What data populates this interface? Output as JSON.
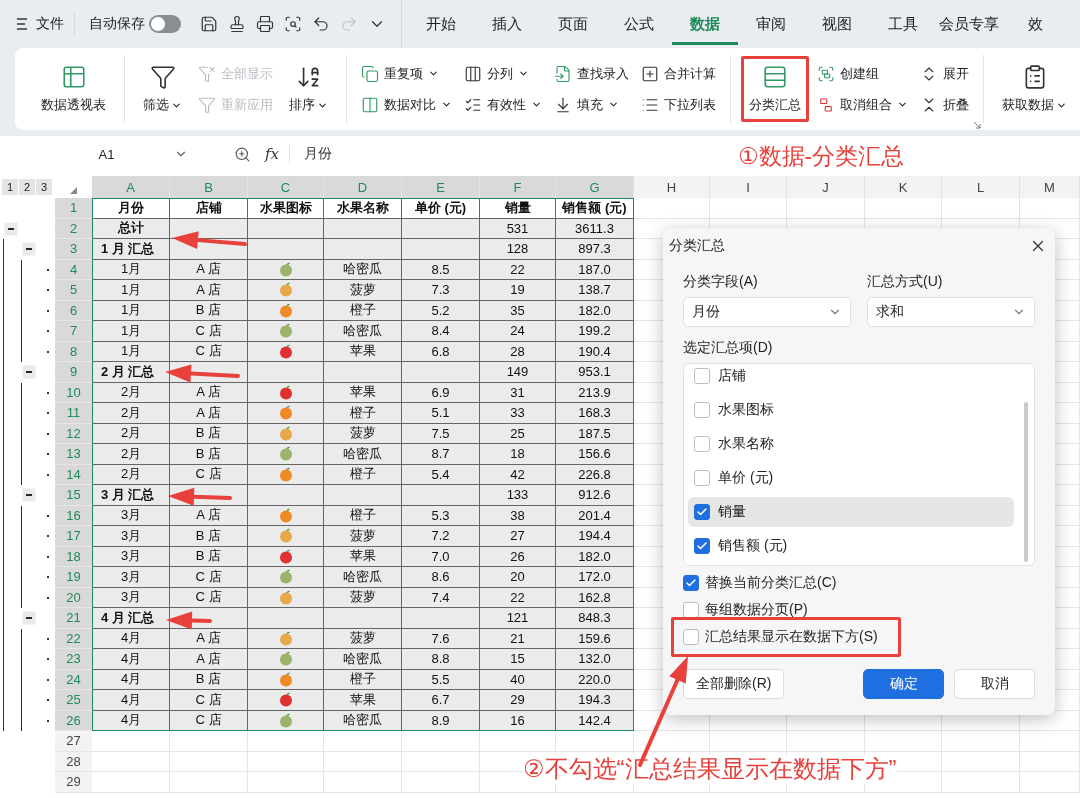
{
  "topbar": {
    "file_menu": "文件",
    "autosave": {
      "label": "自动保存",
      "on": false
    },
    "tabs": [
      {
        "label": "开始",
        "selected": false
      },
      {
        "label": "插入",
        "selected": false
      },
      {
        "label": "页面",
        "selected": false
      },
      {
        "label": "公式",
        "selected": false
      },
      {
        "label": "数据",
        "selected": true
      },
      {
        "label": "审阅",
        "selected": false
      },
      {
        "label": "视图",
        "selected": false
      },
      {
        "label": "工具",
        "selected": false
      },
      {
        "label": "会员专享",
        "selected": false
      },
      {
        "label": "效",
        "selected": false
      }
    ]
  },
  "ribbon": [
    {
      "items": [
        {
          "kind": "large",
          "label": "数据透视表",
          "dropdown": false
        }
      ]
    },
    {
      "items": [
        {
          "kind": "large",
          "label": "筛选",
          "dropdown": true
        },
        {
          "kind": "stack",
          "buttons": [
            {
              "label": "全部显示",
              "dropdown": false,
              "disabled": true
            },
            {
              "label": "重新应用",
              "dropdown": false,
              "disabled": true
            }
          ]
        },
        {
          "kind": "large",
          "label": "排序",
          "dropdown": true
        }
      ]
    },
    {
      "items": [
        {
          "kind": "stack",
          "buttons": [
            {
              "label": "重复项",
              "dropdown": true,
              "disabled": false
            },
            {
              "label": "数据对比",
              "dropdown": true,
              "disabled": false
            }
          ]
        },
        {
          "kind": "stack",
          "buttons": [
            {
              "label": "分列",
              "dropdown": true,
              "disabled": false
            },
            {
              "label": "有效性",
              "dropdown": true,
              "disabled": false
            }
          ]
        },
        {
          "kind": "stack",
          "buttons": [
            {
              "label": "查找录入",
              "dropdown": false,
              "disabled": false
            },
            {
              "label": "填充",
              "dropdown": true,
              "disabled": false
            }
          ]
        },
        {
          "kind": "stack",
          "buttons": [
            {
              "label": "合并计算",
              "dropdown": false,
              "disabled": false
            },
            {
              "label": "下拉列表",
              "dropdown": false,
              "disabled": false
            }
          ]
        }
      ]
    },
    {
      "items": [
        {
          "kind": "large",
          "label": "分类汇总",
          "dropdown": false
        },
        {
          "kind": "stack",
          "buttons": [
            {
              "label": "创建组",
              "dropdown": false,
              "disabled": false
            },
            {
              "label": "取消组合",
              "dropdown": true,
              "disabled": false
            }
          ]
        },
        {
          "kind": "stack",
          "buttons": [
            {
              "label": "展开",
              "dropdown": false,
              "disabled": false
            },
            {
              "label": "折叠",
              "dropdown": false,
              "disabled": false
            }
          ]
        }
      ]
    },
    {
      "items": [
        {
          "kind": "large",
          "label": "获取数据",
          "dropdown": true
        }
      ]
    }
  ],
  "formula_bar": {
    "cell": "A1",
    "fx": "fx",
    "value": "月份"
  },
  "sheet": {
    "outline_levels": [
      "1",
      "2",
      "3"
    ],
    "columns": [
      {
        "letter": "A",
        "selected": true
      },
      {
        "letter": "B",
        "selected": true
      },
      {
        "letter": "C",
        "selected": true
      },
      {
        "letter": "D",
        "selected": true
      },
      {
        "letter": "E",
        "selected": true
      },
      {
        "letter": "F",
        "selected": true
      },
      {
        "letter": "G",
        "selected": true
      },
      {
        "letter": "H",
        "selected": false
      },
      {
        "letter": "I",
        "selected": false
      },
      {
        "letter": "J",
        "selected": false
      },
      {
        "letter": "K",
        "selected": false
      },
      {
        "letter": "L",
        "selected": false
      },
      {
        "letter": "M",
        "selected": false
      }
    ],
    "rows": [
      {
        "number": "1",
        "selected": true,
        "kind": "header",
        "cells": [
          "月份",
          "店铺",
          "水果图标",
          "水果名称",
          "单价 (元)",
          "销量",
          "销售额 (元)"
        ]
      },
      {
        "number": "2",
        "selected": true,
        "kind": "total",
        "label": "总计",
        "qty": "531",
        "amount": "3611.3"
      },
      {
        "number": "3",
        "selected": true,
        "kind": "subtotal",
        "label": "1 月 汇总",
        "qty": "128",
        "amount": "897.3"
      },
      {
        "number": "4",
        "selected": true,
        "kind": "detail",
        "color": "#9bb36a",
        "cells": [
          "1月",
          "A 店",
          "哈密瓜",
          "8.5",
          "22",
          "187.0"
        ]
      },
      {
        "number": "5",
        "selected": true,
        "kind": "detail",
        "color": "#e8a94a",
        "cells": [
          "1月",
          "A 店",
          "菠萝",
          "7.3",
          "19",
          "138.7"
        ]
      },
      {
        "number": "6",
        "selected": true,
        "kind": "detail",
        "color": "#f08a24",
        "cells": [
          "1月",
          "B 店",
          "橙子",
          "5.2",
          "35",
          "182.0"
        ]
      },
      {
        "number": "7",
        "selected": true,
        "kind": "detail",
        "color": "#9bb36a",
        "cells": [
          "1月",
          "C 店",
          "哈密瓜",
          "8.4",
          "24",
          "199.2"
        ]
      },
      {
        "number": "8",
        "selected": true,
        "kind": "detail",
        "color": "#e03030",
        "cells": [
          "1月",
          "C 店",
          "苹果",
          "6.8",
          "28",
          "190.4"
        ]
      },
      {
        "number": "9",
        "selected": true,
        "kind": "subtotal",
        "label": "2 月 汇总",
        "qty": "149",
        "amount": "953.1"
      },
      {
        "number": "10",
        "selected": true,
        "kind": "detail",
        "color": "#e03030",
        "cells": [
          "2月",
          "A 店",
          "苹果",
          "6.9",
          "31",
          "213.9"
        ]
      },
      {
        "number": "11",
        "selected": true,
        "kind": "detail",
        "color": "#f08a24",
        "cells": [
          "2月",
          "A 店",
          "橙子",
          "5.1",
          "33",
          "168.3"
        ]
      },
      {
        "number": "12",
        "selected": true,
        "kind": "detail",
        "color": "#e8a94a",
        "cells": [
          "2月",
          "B 店",
          "菠萝",
          "7.5",
          "25",
          "187.5"
        ]
      },
      {
        "number": "13",
        "selected": true,
        "kind": "detail",
        "color": "#9bb36a",
        "cells": [
          "2月",
          "B 店",
          "哈密瓜",
          "8.7",
          "18",
          "156.6"
        ]
      },
      {
        "number": "14",
        "selected": true,
        "kind": "detail",
        "color": "#f08a24",
        "cells": [
          "2月",
          "C 店",
          "橙子",
          "5.4",
          "42",
          "226.8"
        ]
      },
      {
        "number": "15",
        "selected": true,
        "kind": "subtotal",
        "label": "3 月 汇总",
        "qty": "133",
        "amount": "912.6"
      },
      {
        "number": "16",
        "selected": true,
        "kind": "detail",
        "color": "#f08a24",
        "cells": [
          "3月",
          "A 店",
          "橙子",
          "5.3",
          "38",
          "201.4"
        ]
      },
      {
        "number": "17",
        "selected": true,
        "kind": "detail",
        "color": "#e8a94a",
        "cells": [
          "3月",
          "B 店",
          "菠萝",
          "7.2",
          "27",
          "194.4"
        ]
      },
      {
        "number": "18",
        "selected": true,
        "kind": "detail",
        "color": "#e03030",
        "cells": [
          "3月",
          "B 店",
          "苹果",
          "7.0",
          "26",
          "182.0"
        ]
      },
      {
        "number": "19",
        "selected": true,
        "kind": "detail",
        "color": "#9bb36a",
        "cells": [
          "3月",
          "C 店",
          "哈密瓜",
          "8.6",
          "20",
          "172.0"
        ]
      },
      {
        "number": "20",
        "selected": true,
        "kind": "detail",
        "color": "#e8a94a",
        "cells": [
          "3月",
          "C 店",
          "菠萝",
          "7.4",
          "22",
          "162.8"
        ]
      },
      {
        "number": "21",
        "selected": true,
        "kind": "subtotal",
        "label": "4 月 汇总",
        "qty": "121",
        "amount": "848.3"
      },
      {
        "number": "22",
        "selected": true,
        "kind": "detail",
        "color": "#e8a94a",
        "cells": [
          "4月",
          "A 店",
          "菠萝",
          "7.6",
          "21",
          "159.6"
        ]
      },
      {
        "number": "23",
        "selected": true,
        "kind": "detail",
        "color": "#9bb36a",
        "cells": [
          "4月",
          "A 店",
          "哈密瓜",
          "8.8",
          "15",
          "132.0"
        ]
      },
      {
        "number": "24",
        "selected": true,
        "kind": "detail",
        "color": "#f08a24",
        "cells": [
          "4月",
          "B 店",
          "橙子",
          "5.5",
          "40",
          "220.0"
        ]
      },
      {
        "number": "25",
        "selected": true,
        "kind": "detail",
        "color": "#e03030",
        "cells": [
          "4月",
          "C 店",
          "苹果",
          "6.7",
          "29",
          "194.3"
        ]
      },
      {
        "number": "26",
        "selected": true,
        "kind": "detail",
        "color": "#9bb36a",
        "cells": [
          "4月",
          "C 店",
          "哈密瓜",
          "8.9",
          "16",
          "142.4"
        ]
      },
      {
        "number": "27",
        "selected": false,
        "kind": "empty"
      },
      {
        "number": "28",
        "selected": false,
        "kind": "empty"
      },
      {
        "number": "29",
        "selected": false,
        "kind": "empty"
      }
    ]
  },
  "dialog": {
    "title": "分类汇总",
    "fields": [
      {
        "label": "分类字段(A)",
        "value": "月份"
      },
      {
        "label": "汇总方式(U)",
        "value": "求和"
      }
    ],
    "list_label": "选定汇总项(D)",
    "items": [
      {
        "label": "店铺",
        "checked": false,
        "selected": false
      },
      {
        "label": "水果图标",
        "checked": false,
        "selected": false
      },
      {
        "label": "水果名称",
        "checked": false,
        "selected": false
      },
      {
        "label": "单价 (元)",
        "checked": false,
        "selected": false
      },
      {
        "label": "销量",
        "checked": true,
        "selected": true
      },
      {
        "label": "销售额 (元)",
        "checked": true,
        "selected": false
      }
    ],
    "options": [
      {
        "label": "替换当前分类汇总(C)",
        "checked": true
      },
      {
        "label": "每组数据分页(P)",
        "checked": false
      },
      {
        "label": "汇总结果显示在数据下方(S)",
        "checked": false
      }
    ],
    "buttons": [
      {
        "label": "全部删除(R)",
        "kind": "default"
      },
      {
        "label": "确定",
        "kind": "primary"
      },
      {
        "label": "取消",
        "kind": "default"
      }
    ]
  },
  "annotations": {
    "step1": "①数据-分类汇总",
    "step2": "②不勾选“汇总结果显示在数据下方”"
  }
}
